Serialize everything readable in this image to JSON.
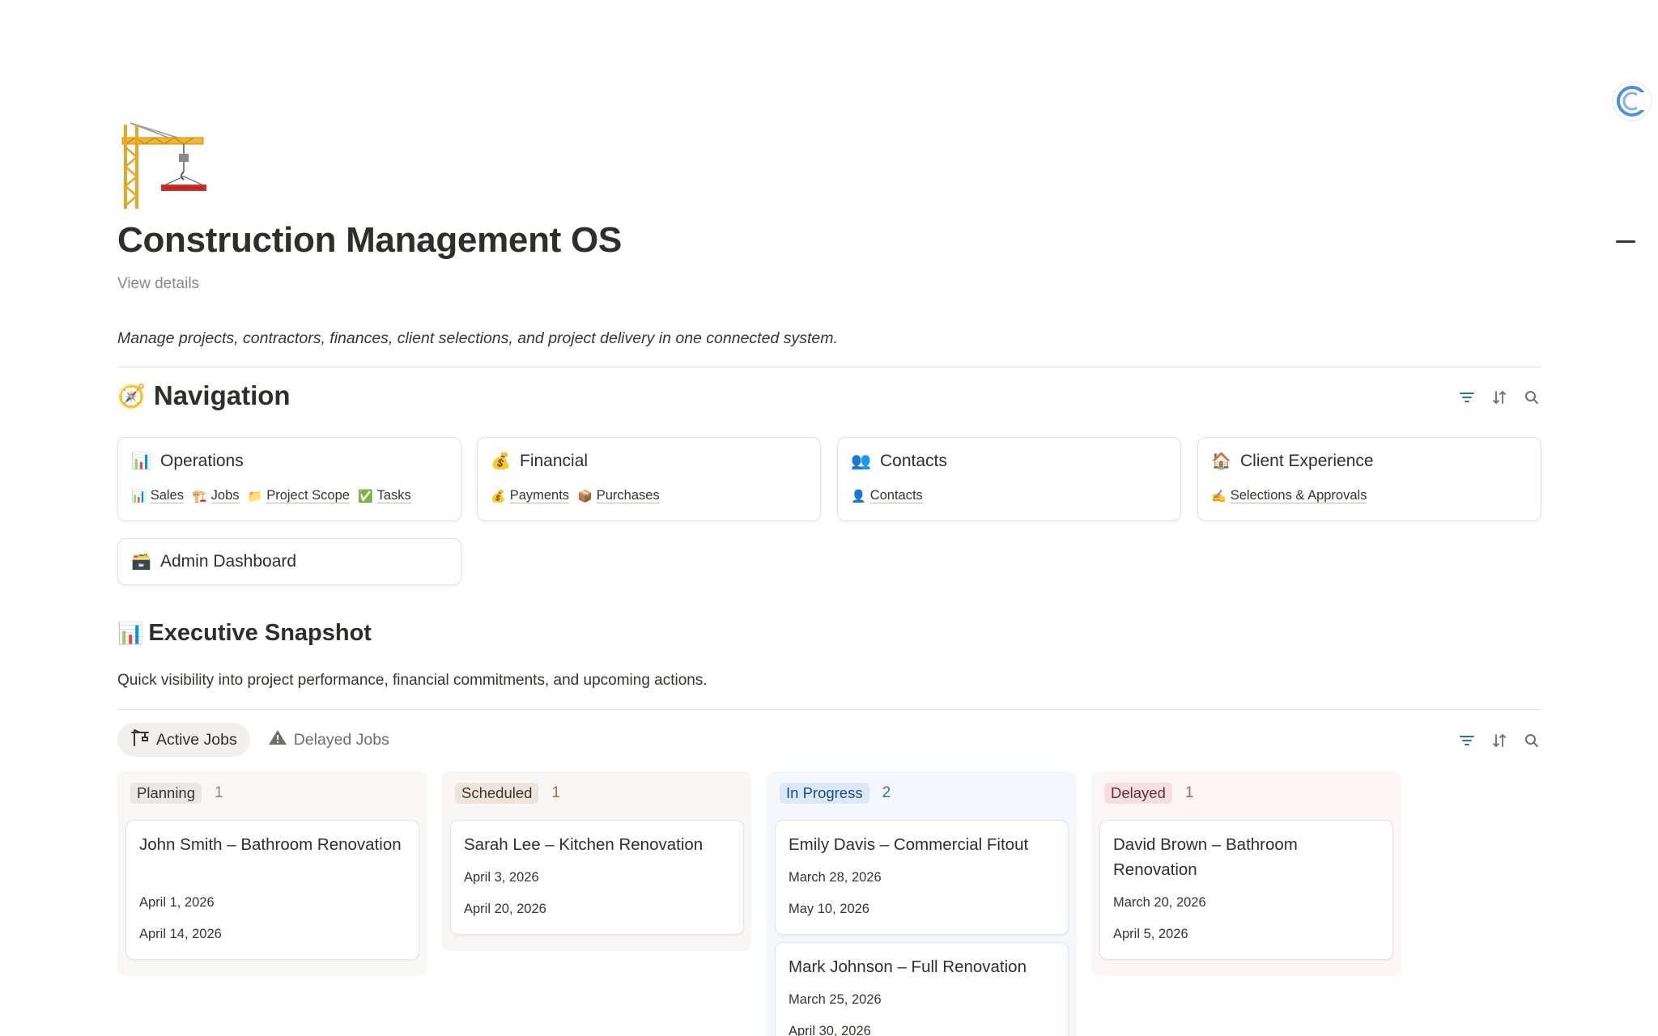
{
  "page": {
    "icon": "construction-crane-icon",
    "title": "Construction Management OS",
    "view_details": "View details",
    "subtitle": "Manage projects, contractors, finances, client selections, and project delivery in one connected system."
  },
  "navigation": {
    "emoji": "🧭",
    "title": "Navigation",
    "cards": [
      {
        "icon": "📊",
        "title": "Operations",
        "links": [
          {
            "icon": "📊",
            "label": "Sales"
          },
          {
            "icon": "🏗️",
            "label": "Jobs"
          },
          {
            "icon": "📁",
            "label": "Project Scope"
          },
          {
            "icon": "✅",
            "label": "Tasks"
          }
        ]
      },
      {
        "icon": "💰",
        "title": "Financial",
        "links": [
          {
            "icon": "💰",
            "label": "Payments"
          },
          {
            "icon": "📦",
            "label": "Purchases"
          }
        ]
      },
      {
        "icon": "👥",
        "title": "Contacts",
        "links": [
          {
            "icon": "👤",
            "label": "Contacts"
          }
        ]
      },
      {
        "icon": "🏠",
        "title": "Client Experience",
        "links": [
          {
            "icon": "✍️",
            "label": "Selections & Approvals"
          }
        ]
      },
      {
        "icon": "🗃️",
        "title": "Admin Dashboard",
        "links": []
      }
    ]
  },
  "snapshot": {
    "emoji": "📊",
    "title": "Executive Snapshot",
    "description": "Quick visibility into project performance, financial commitments, and upcoming actions.",
    "tabs": [
      {
        "icon": "crane-icon",
        "label": "Active Jobs",
        "active": true
      },
      {
        "icon": "warning-icon",
        "label": "Delayed Jobs",
        "active": false
      }
    ],
    "columns": [
      {
        "status": "Planning",
        "count": "1",
        "bg": "#f9f8f7",
        "pill_bg": "#e9e8e5",
        "pill_color": "#37352f",
        "count_color": "#8a8984",
        "cards": [
          {
            "title": "John Smith – Bathroom Renovation",
            "start": "April 1, 2026",
            "end": "April 14, 2026"
          }
        ]
      },
      {
        "status": "Scheduled",
        "count": "1",
        "bg": "#f9f7f6",
        "pill_bg": "#eee4dc",
        "pill_color": "#44332a",
        "count_color": "#b86b3d",
        "cards": [
          {
            "title": "Sarah Lee – Kitchen Renovation",
            "start": "April 3, 2026",
            "end": "April 20, 2026"
          }
        ]
      },
      {
        "status": "In Progress",
        "count": "2",
        "bg": "#f4f8fc",
        "pill_bg": "#dbeafb",
        "pill_color": "#1f4a7a",
        "count_color": "#2f6db5",
        "cards": [
          {
            "title": "Emily Davis – Commercial Fitout",
            "start": "March 28, 2026",
            "end": "May 10, 2026"
          },
          {
            "title": "Mark Johnson – Full Renovation",
            "start": "March 25, 2026",
            "end": "April 30, 2026"
          }
        ]
      },
      {
        "status": "Delayed",
        "count": "1",
        "bg": "#fcf6f7",
        "pill_bg": "#f6dfe3",
        "pill_color": "#5e2f38",
        "count_color": "#c4566a",
        "cards": [
          {
            "title": "David Brown – Bathroom Renovation",
            "start": "March 20, 2026",
            "end": "April 5, 2026"
          }
        ]
      }
    ]
  },
  "icons": {
    "filter": "filter-icon",
    "sort": "sort-icon",
    "search": "search-icon",
    "accent": "#2f6db5"
  }
}
